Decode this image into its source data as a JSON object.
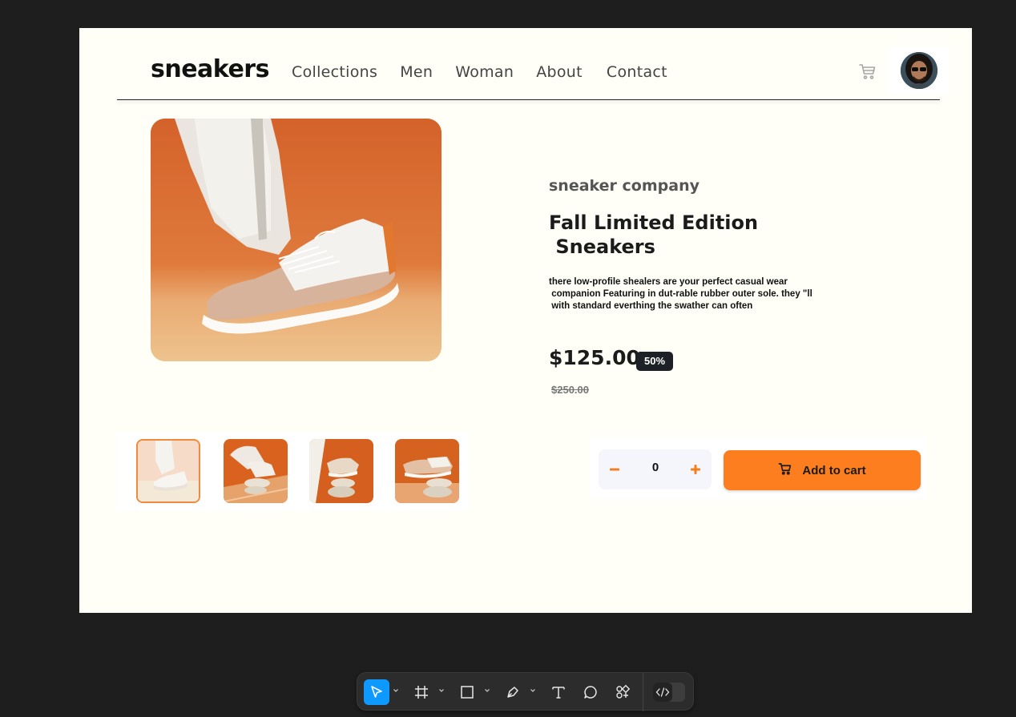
{
  "header": {
    "logo": "sneakers",
    "nav": [
      "Collections",
      "Men",
      "Woman",
      "About",
      "Contact"
    ]
  },
  "icons": {
    "cart": "cart-icon",
    "avatar": "user-avatar"
  },
  "product": {
    "brand": "sneaker company",
    "title": "Fall Limited Edition\n Sneakers",
    "description": "there low-profile shealers are your perfect casual wear\n companion Featuring in dut-rable rubber outer sole. they \"ll\n with standard everthing the swather can often",
    "price": "$125.00",
    "discount": "50%",
    "old_price": "$250.00",
    "quantity": "0",
    "add_to_cart": "Add to cart",
    "active_thumbnail": 1
  },
  "colors": {
    "accent": "#fd7e1e",
    "dark": "#1d2025",
    "background": "#fffff7",
    "canvas": "#1e1e1e",
    "tool_active": "#0d99ff"
  },
  "toolbar": {
    "tools": [
      "move-tool",
      "frame-tool",
      "shape-tool",
      "pen-tool",
      "text-tool",
      "comment-tool",
      "actions-tool",
      "dev-mode-toggle"
    ],
    "active": "move-tool"
  }
}
